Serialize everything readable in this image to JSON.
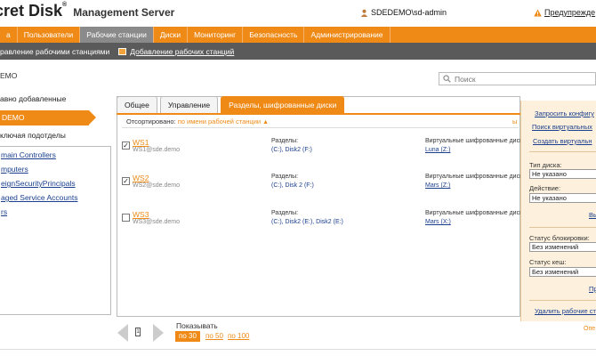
{
  "header": {
    "logo_main": "cret Disk",
    "logo_reg": "®",
    "logo_sub": "Management Server",
    "user": "SDEDEMO\\sd-admin",
    "warning": "Предупрежде"
  },
  "nav": {
    "tabs": [
      {
        "label": "а"
      },
      {
        "label": "Пользователи"
      },
      {
        "label": "Рабочие станции"
      },
      {
        "label": "Диски"
      },
      {
        "label": "Мониторинг"
      },
      {
        "label": "Безопасность"
      },
      {
        "label": "Администрирование"
      }
    ]
  },
  "subnav": {
    "manage": "равление рабочими станциями",
    "add": "Добавление рабочих станций"
  },
  "breadcrumb": "ЕМО",
  "search": {
    "placeholder": "Поиск"
  },
  "left": {
    "recent": "авно добавленные",
    "selected": "DEMO",
    "include_sub": "ключая подотделы",
    "tree": [
      "main Controllers",
      "mputers",
      "eignSecurityPrincipals",
      "aged Service Accounts",
      "rs"
    ]
  },
  "panel": {
    "tabs": [
      "Общее",
      "Управление",
      "Разделы, шифрованные диски"
    ],
    "sorted_label": "Отсортировано:",
    "sorted_value": "по имени рабочей станции",
    "cut_link": "ы",
    "rows": [
      {
        "name": "WS1",
        "dns": "WS1@sde.demo",
        "checked": true,
        "partitions_label": "Разделы:",
        "partitions": "(C:), Disk2 (F:)",
        "vdisks_label": "Виртуальные шифрованные диски",
        "vdisks": "Luna (Z:)"
      },
      {
        "name": "WS2",
        "dns": "WS2@sde.demo",
        "checked": true,
        "partitions_label": "Разделы:",
        "partitions": "(C:), Disk 2 (F:)",
        "vdisks_label": "Виртуальные шифрованные диски",
        "vdisks": "Mars (Z:)"
      },
      {
        "name": "WS3",
        "dns": "WS3@sde.demo",
        "checked": false,
        "partitions_label": "Разделы:",
        "partitions": "(C:), Disk2 (E:), Disk2 (E:)",
        "vdisks_label": "Виртуальные шифрованные диски",
        "vdisks": "Mars (X:)"
      }
    ]
  },
  "pager": {
    "page": "1",
    "show_label": "Показывать",
    "sizes": [
      "по 30",
      "по 50",
      "по 100"
    ]
  },
  "rpanel": {
    "link1": "Запросить конфигу",
    "link2": "Поиск виртуальных",
    "link3": "Создать виртуальн",
    "disk_type_label": "Тип диска:",
    "disk_type_value": "Не указано",
    "action_label": "Действие:",
    "action_value": "Не указано",
    "exec1": "Вы",
    "lock_label": "Статус блокировки:",
    "lock_value": "Без изменений",
    "cache_label": "Статус кеш:",
    "cache_value": "Без изменений",
    "apply": "Пр",
    "delete_link": "Удалить рабочие ст",
    "footer_note": "Опе"
  },
  "colors": {
    "accent": "#ef8a17",
    "subnav": "#5a5a5a",
    "active_tab": "#8a8a8a",
    "link": "#1a3f8f"
  }
}
